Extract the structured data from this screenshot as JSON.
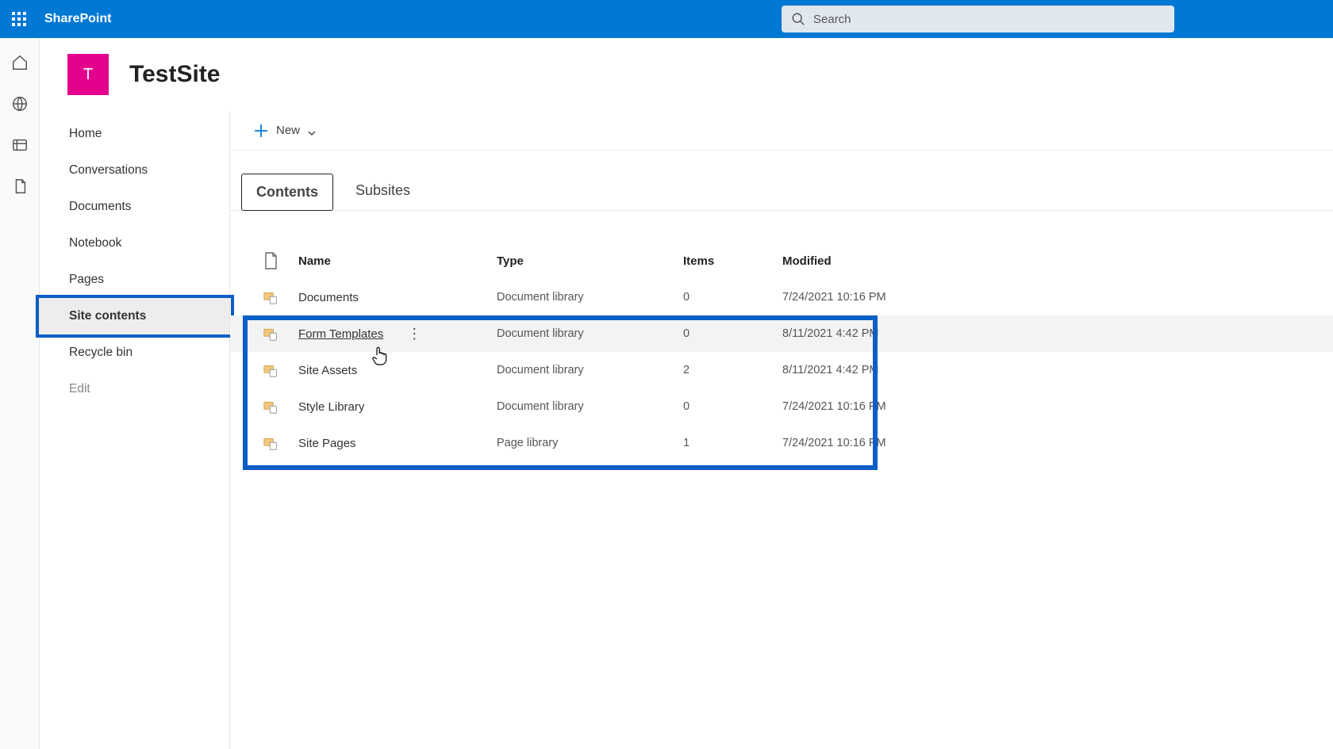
{
  "suite": {
    "app_name": "SharePoint",
    "search_placeholder": "Search"
  },
  "site": {
    "logo_letter": "T",
    "title": "TestSite"
  },
  "left_nav": {
    "items": [
      {
        "label": "Home"
      },
      {
        "label": "Conversations"
      },
      {
        "label": "Documents"
      },
      {
        "label": "Notebook"
      },
      {
        "label": "Pages"
      },
      {
        "label": "Site contents",
        "selected": true
      },
      {
        "label": "Recycle bin"
      },
      {
        "label": "Edit",
        "faded": true
      }
    ]
  },
  "command_bar": {
    "new_label": "New"
  },
  "tabs": {
    "contents": "Contents",
    "subsites": "Subsites"
  },
  "table": {
    "headers": {
      "name": "Name",
      "type": "Type",
      "items": "Items",
      "modified": "Modified"
    },
    "rows": [
      {
        "name": "Documents",
        "type": "Document library",
        "items": "0",
        "modified": "7/24/2021 10:16 PM"
      },
      {
        "name": "Form Templates",
        "type": "Document library",
        "items": "0",
        "modified": "8/11/2021 4:42 PM",
        "hover": true
      },
      {
        "name": "Site Assets",
        "type": "Document library",
        "items": "2",
        "modified": "8/11/2021 4:42 PM"
      },
      {
        "name": "Style Library",
        "type": "Document library",
        "items": "0",
        "modified": "7/24/2021 10:16 PM"
      },
      {
        "name": "Site Pages",
        "type": "Page library",
        "items": "1",
        "modified": "7/24/2021 10:16 PM"
      }
    ]
  },
  "colors": {
    "brand": "#0078d4",
    "site_accent": "#e3008c",
    "highlight": "#0a5ec5"
  }
}
